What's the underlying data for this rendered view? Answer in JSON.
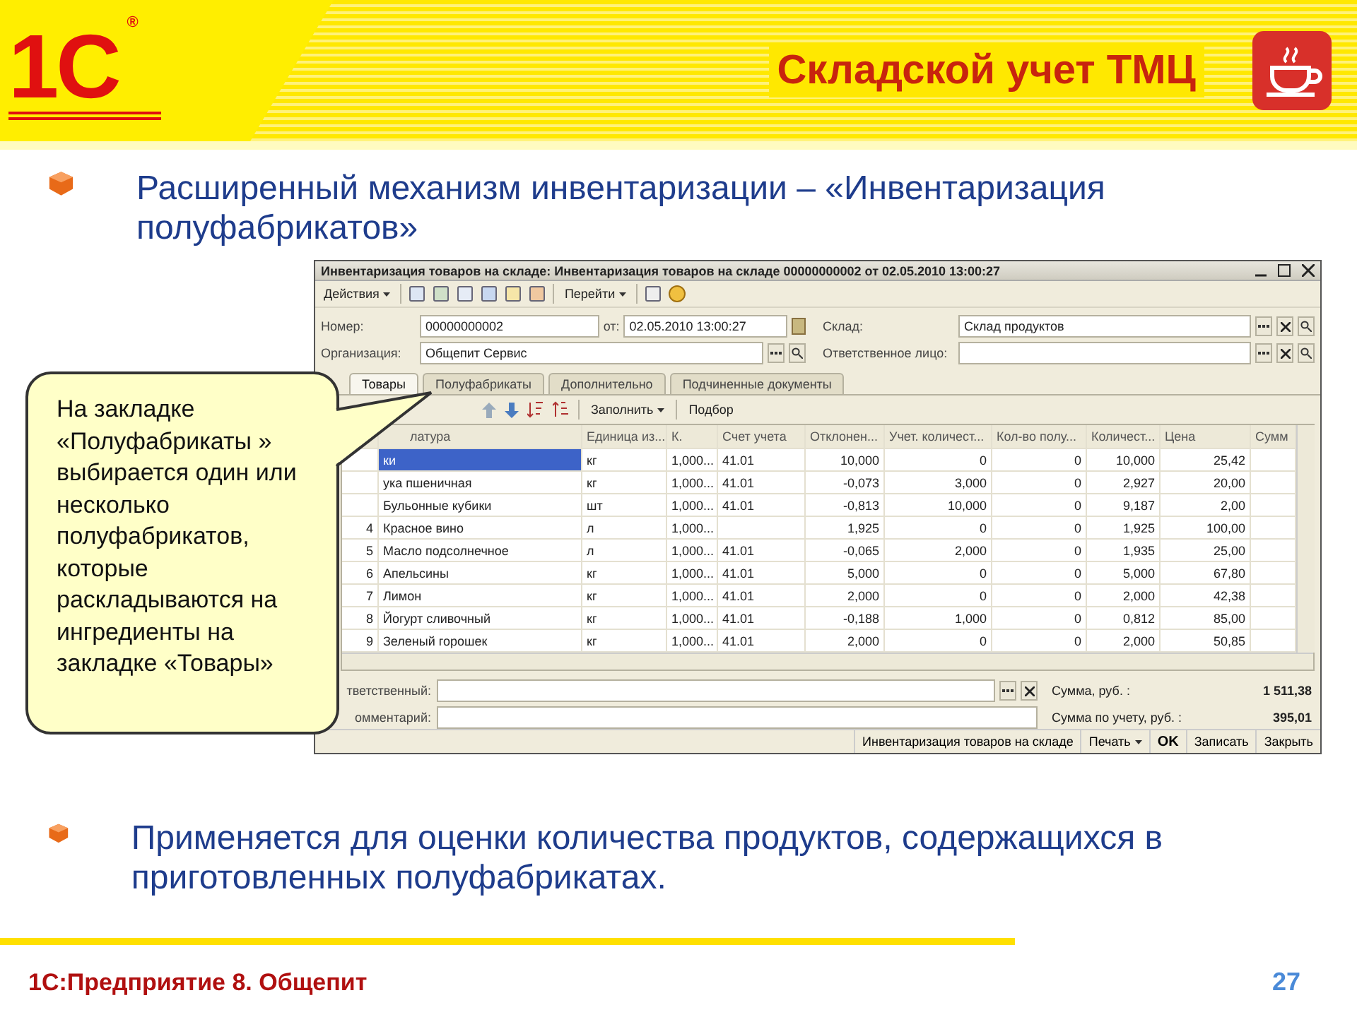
{
  "header": {
    "logo": "1С",
    "logo_mark": "®",
    "title": "Складской учет ТМЦ"
  },
  "intro_bullet": "Расширенный механизм инвентаризации – «Инвентаризация полуфабрикатов»",
  "window": {
    "title": "Инвентаризация товаров на складе: Инвентаризация товаров на складе 00000000002 от 02.05.2010 13:00:27",
    "toolbar": {
      "actions_menu": "Действия",
      "goto_menu": "Перейти"
    },
    "form": {
      "number": {
        "label": "Номер:",
        "value": "00000000002"
      },
      "date": {
        "label": "от:",
        "value": "02.05.2010 13:00:27"
      },
      "warehouse": {
        "label": "Склад:",
        "value": "Склад продуктов"
      },
      "organization": {
        "label": "Организация:",
        "value": "Общепит Сервис"
      },
      "responsible_person": {
        "label": "Ответственное лицо:"
      }
    },
    "tabs": [
      {
        "label": "Товары",
        "selected": true
      },
      {
        "label": "Полуфабрикаты",
        "selected": false
      },
      {
        "label": "Дополнительно",
        "selected": false
      },
      {
        "label": "Подчиненные документы",
        "selected": false
      }
    ],
    "table_toolbar": {
      "fill_menu": "Заполнить",
      "pick_button": "Подбор"
    },
    "table": {
      "columns": [
        {
          "label": "латура"
        },
        {
          "label": "Единица из..."
        },
        {
          "label": "К."
        },
        {
          "label": "Счет учета"
        },
        {
          "label": "Отклонен..."
        },
        {
          "label": "Учет. количест..."
        },
        {
          "label": "Кол-во полу..."
        },
        {
          "label": "Количест..."
        },
        {
          "label": "Цена"
        },
        {
          "label": "Сумм"
        }
      ],
      "rows": [
        {
          "name": "ки",
          "unit": "кг",
          "factor": "1,000...",
          "account": "41.01",
          "deviation": "10,000",
          "accounted": "0",
          "semi": "0",
          "quantity": "10,000",
          "price": "25,42",
          "selected": true
        },
        {
          "name": "ука пшеничная",
          "unit": "кг",
          "factor": "1,000...",
          "account": "41.01",
          "deviation": "-0,073",
          "accounted": "3,000",
          "semi": "0",
          "quantity": "2,927",
          "price": "20,00",
          "selected": false
        },
        {
          "name": "Бульонные кубики",
          "unit": "шт",
          "factor": "1,000...",
          "account": "41.01",
          "deviation": "-0,813",
          "accounted": "10,000",
          "semi": "0",
          "quantity": "9,187",
          "price": "2,00",
          "selected": false
        },
        {
          "number": "4",
          "name": "Красное вино",
          "unit": "л",
          "factor": "1,000...",
          "deviation": "1,925",
          "accounted": "0",
          "semi": "0",
          "quantity": "1,925",
          "price": "100,00",
          "selected": false
        },
        {
          "number": "5",
          "name": "Масло подсолнечное",
          "unit": "л",
          "factor": "1,000...",
          "account": "41.01",
          "deviation": "-0,065",
          "accounted": "2,000",
          "semi": "0",
          "quantity": "1,935",
          "price": "25,00",
          "selected": false
        },
        {
          "number": "6",
          "name": "Апельсины",
          "unit": "кг",
          "factor": "1,000...",
          "account": "41.01",
          "deviation": "5,000",
          "accounted": "0",
          "semi": "0",
          "quantity": "5,000",
          "price": "67,80",
          "selected": false
        },
        {
          "number": "7",
          "name": "Лимон",
          "unit": "кг",
          "factor": "1,000...",
          "account": "41.01",
          "deviation": "2,000",
          "accounted": "0",
          "semi": "0",
          "quantity": "2,000",
          "price": "42,38",
          "selected": false
        },
        {
          "number": "8",
          "name": "Йогурт сливочный",
          "unit": "кг",
          "factor": "1,000...",
          "account": "41.01",
          "deviation": "-0,188",
          "accounted": "1,000",
          "semi": "0",
          "quantity": "0,812",
          "price": "85,00",
          "selected": false
        },
        {
          "number": "9",
          "name": "Зеленый горошек",
          "unit": "кг",
          "factor": "1,000...",
          "account": "41.01",
          "deviation": "2,000",
          "accounted": "0",
          "semi": "0",
          "quantity": "2,000",
          "price": "50,85",
          "selected": false
        }
      ]
    },
    "bottom": {
      "responsible": {
        "label": "тветственный:"
      },
      "comment": {
        "label": "омментарий:"
      },
      "totals": [
        {
          "label": "Сумма, руб. :",
          "value": "1 511,38"
        },
        {
          "label": "Сумма по учету, руб. :",
          "value": "395,01"
        }
      ]
    },
    "buttons": [
      {
        "kind": "link",
        "label": "Инвентаризация товаров на складе"
      },
      {
        "kind": "menu",
        "label": "Печать"
      },
      {
        "kind": "default",
        "label": "OK"
      },
      {
        "kind": "plain",
        "label": "Записать"
      },
      {
        "kind": "plain",
        "label": "Закрыть"
      }
    ]
  },
  "callout": "На закладке «Полуфабрикаты » выбирается один или несколько полуфабрикатов, которые раскладываются на ингредиенты на закладке «Товары»",
  "closing_bullet": "Применяется для оценки количества продуктов, содержащихся в приготовленных полуфабрикатах.",
  "footer": {
    "product": "1С:Предприятие 8. Общепит",
    "page": "27"
  }
}
